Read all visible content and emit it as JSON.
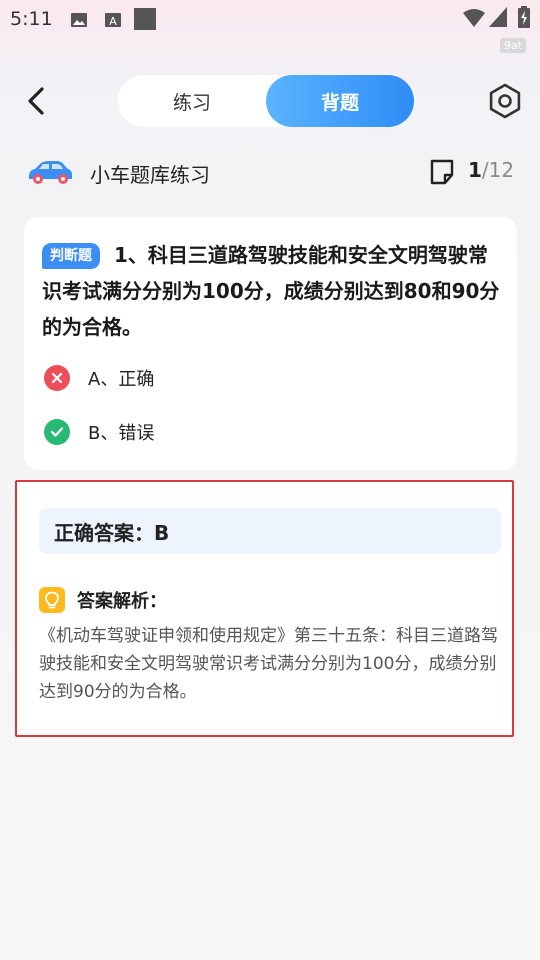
{
  "status_bar": {
    "time": "5:11",
    "icons": [
      "image-icon",
      "font-icon",
      "stop-icon",
      "wifi-icon",
      "signal-icon",
      "battery-icon"
    ],
    "badge": "9at"
  },
  "header": {
    "tabs": [
      {
        "label": "练习",
        "active": false
      },
      {
        "label": "背题",
        "active": true
      }
    ]
  },
  "info": {
    "title": "小车题库练习",
    "current": "1",
    "total": "/12"
  },
  "question": {
    "tag": "判断题",
    "text": "1、科目三道路驾驶技能和安全文明驾驶常识考试满分分别为100分，成绩分别达到80和90分的为合格。",
    "options": [
      {
        "label": "A、正确",
        "state": "wrong"
      },
      {
        "label": "B、错误",
        "state": "correct"
      }
    ]
  },
  "answer": {
    "correct_label": "正确答案：B",
    "analysis_title": "答案解析：",
    "analysis_text": "《机动车驾驶证申领和使用规定》第三十五条：科目三道路驾驶技能和安全文明驾驶常识考试满分分别为100分，成绩分别达到90分的为合格。"
  },
  "colors": {
    "accent": "#3d8ef2",
    "wrong": "#ee4d5a",
    "right": "#28b975",
    "highlight_border": "#d63a3a"
  }
}
